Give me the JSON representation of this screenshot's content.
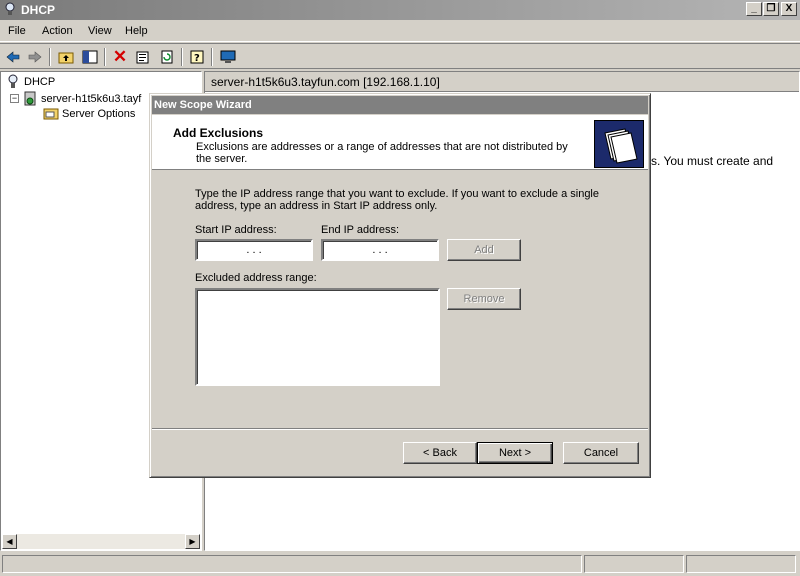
{
  "window": {
    "title": "DHCP",
    "min": "_",
    "restore": "❐",
    "close": "X"
  },
  "menu": [
    "File",
    "Action",
    "View",
    "Help"
  ],
  "tree": {
    "root": "DHCP",
    "server": "server-h1t5k6u3.tayf",
    "server_options": "Server Options"
  },
  "detail": {
    "header": "server-h1t5k6u3.tayfun.com [192.168.1.10]",
    "text": "s. You must create and"
  },
  "dialog": {
    "title": "New Scope Wizard",
    "header_title": "Add Exclusions",
    "header_desc": "Exclusions are addresses or a range of addresses that are not distributed by the server.",
    "instructions": "Type the IP address range that you want to exclude. If you want to exclude a single address, type an address in Start IP address only.",
    "start_ip_label": "Start IP address:",
    "end_ip_label": "End IP address:",
    "start_ip_value": ". . .",
    "end_ip_value": ". . .",
    "add_label": "Add",
    "excluded_label": "Excluded address range:",
    "remove_label": "Remove",
    "back_label": "< Back",
    "next_label": "Next >",
    "cancel_label": "Cancel"
  },
  "icons": {
    "app": "dhcp-icon",
    "back": "back-arrow-icon",
    "forward": "forward-arrow-icon",
    "up": "up-folder-icon",
    "show_tree": "show-tree-icon",
    "delete": "delete-icon",
    "properties": "properties-icon",
    "refresh": "refresh-icon",
    "help": "help-icon",
    "console": "console-icon",
    "wizard": "folders-icon"
  },
  "colors": {
    "delete_red": "#d40000",
    "dialog_title_bg": "#808080",
    "wizard_icon_bg": "#1c2a6b"
  }
}
